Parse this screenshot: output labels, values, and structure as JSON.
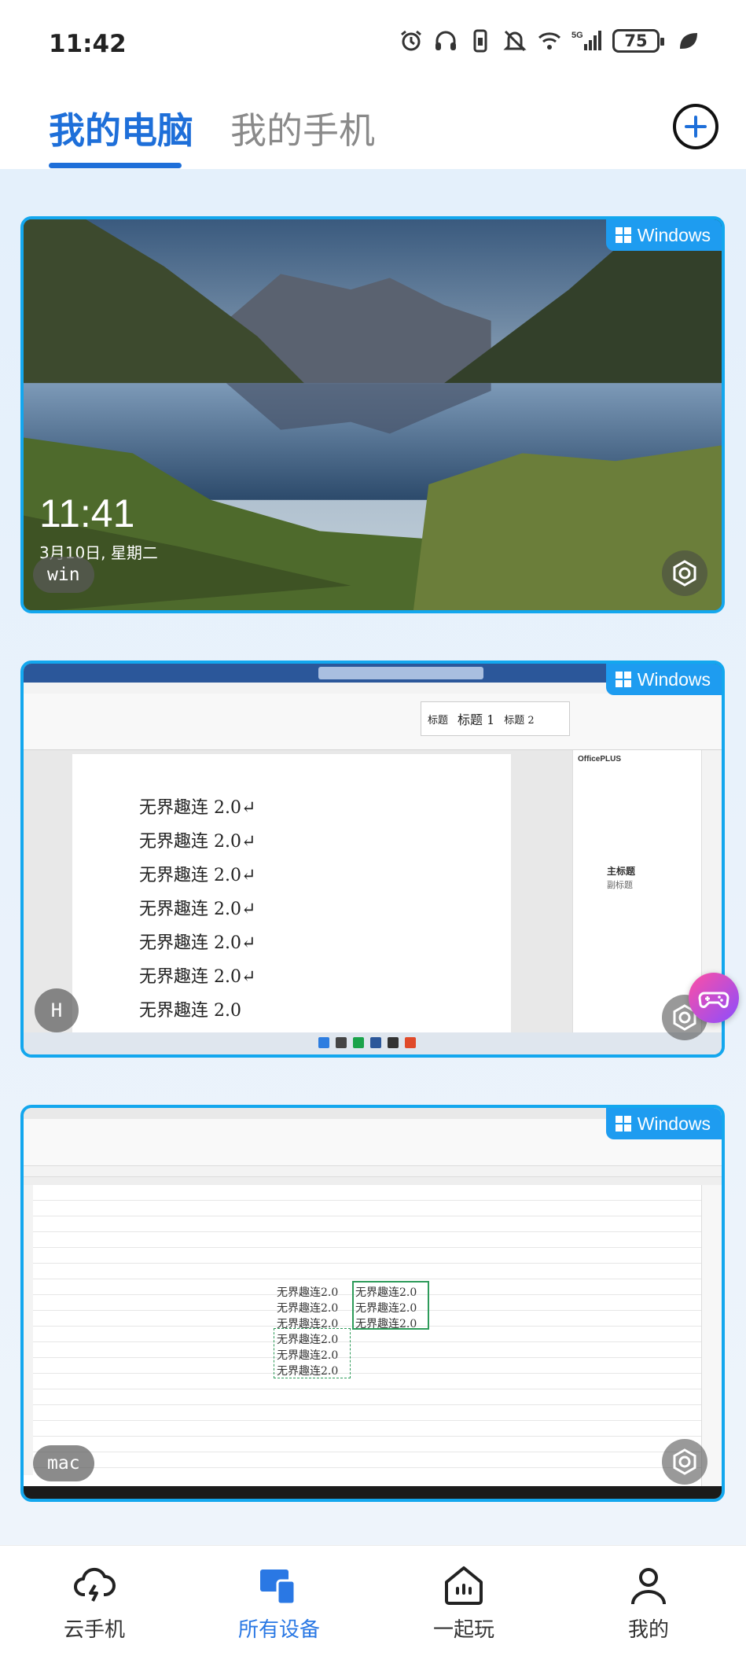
{
  "status_bar": {
    "time": "11:42",
    "icons": [
      "alarm-icon",
      "headphones-icon",
      "vibrate-icon",
      "mute-icon",
      "wifi-icon",
      "5g-signal-icon",
      "battery-icon",
      "leaf-icon"
    ],
    "battery_level": "75"
  },
  "header": {
    "tabs": [
      {
        "label": "我的电脑",
        "active": true
      },
      {
        "label": "我的手机",
        "active": false
      }
    ],
    "add_icon": "plus-circle-icon"
  },
  "devices": [
    {
      "os_badge": "Windows",
      "name": "win",
      "screen": "lock-screen",
      "lock_time": "11:41",
      "lock_date": "3月10日, 星期二"
    },
    {
      "os_badge": "Windows",
      "name": "H",
      "screen": "word-document",
      "doc_lines": [
        "无界趣连 2.0↵",
        "无界趣连 2.0↵",
        "无界趣连 2.0↵",
        "无界趣连 2.0↵",
        "无界趣连 2.0↵",
        "无界趣连 2.0↵",
        "无界趣连 2.0"
      ],
      "styles": [
        "标题",
        "标题 1",
        "标题 2"
      ],
      "pane_title": "OfficePLUS",
      "pane_headings": [
        "主标题",
        "副标题"
      ]
    },
    {
      "os_badge": "Windows",
      "name": "mac",
      "screen": "spreadsheet",
      "cells": [
        "无界趣连2.0",
        "无界趣连2.0",
        "无界趣连2.0",
        "无界趣连2.0",
        "无界趣连2.0",
        "无界趣连2.0",
        "无界趣连2.0",
        "无界趣连2.0",
        "无界趣连2.0"
      ]
    }
  ],
  "bottom_nav": [
    {
      "label": "云手机",
      "icon": "cloud-lightning-icon",
      "active": false
    },
    {
      "label": "所有设备",
      "icon": "devices-icon",
      "active": true
    },
    {
      "label": "一起玩",
      "icon": "home-play-icon",
      "active": false
    },
    {
      "label": "我的",
      "icon": "person-icon",
      "active": false
    }
  ],
  "colors": {
    "accent": "#1e6fd9",
    "badge": "#1e9cf0",
    "card_border": "#13a7ee",
    "nav_active": "#2a78e4"
  }
}
